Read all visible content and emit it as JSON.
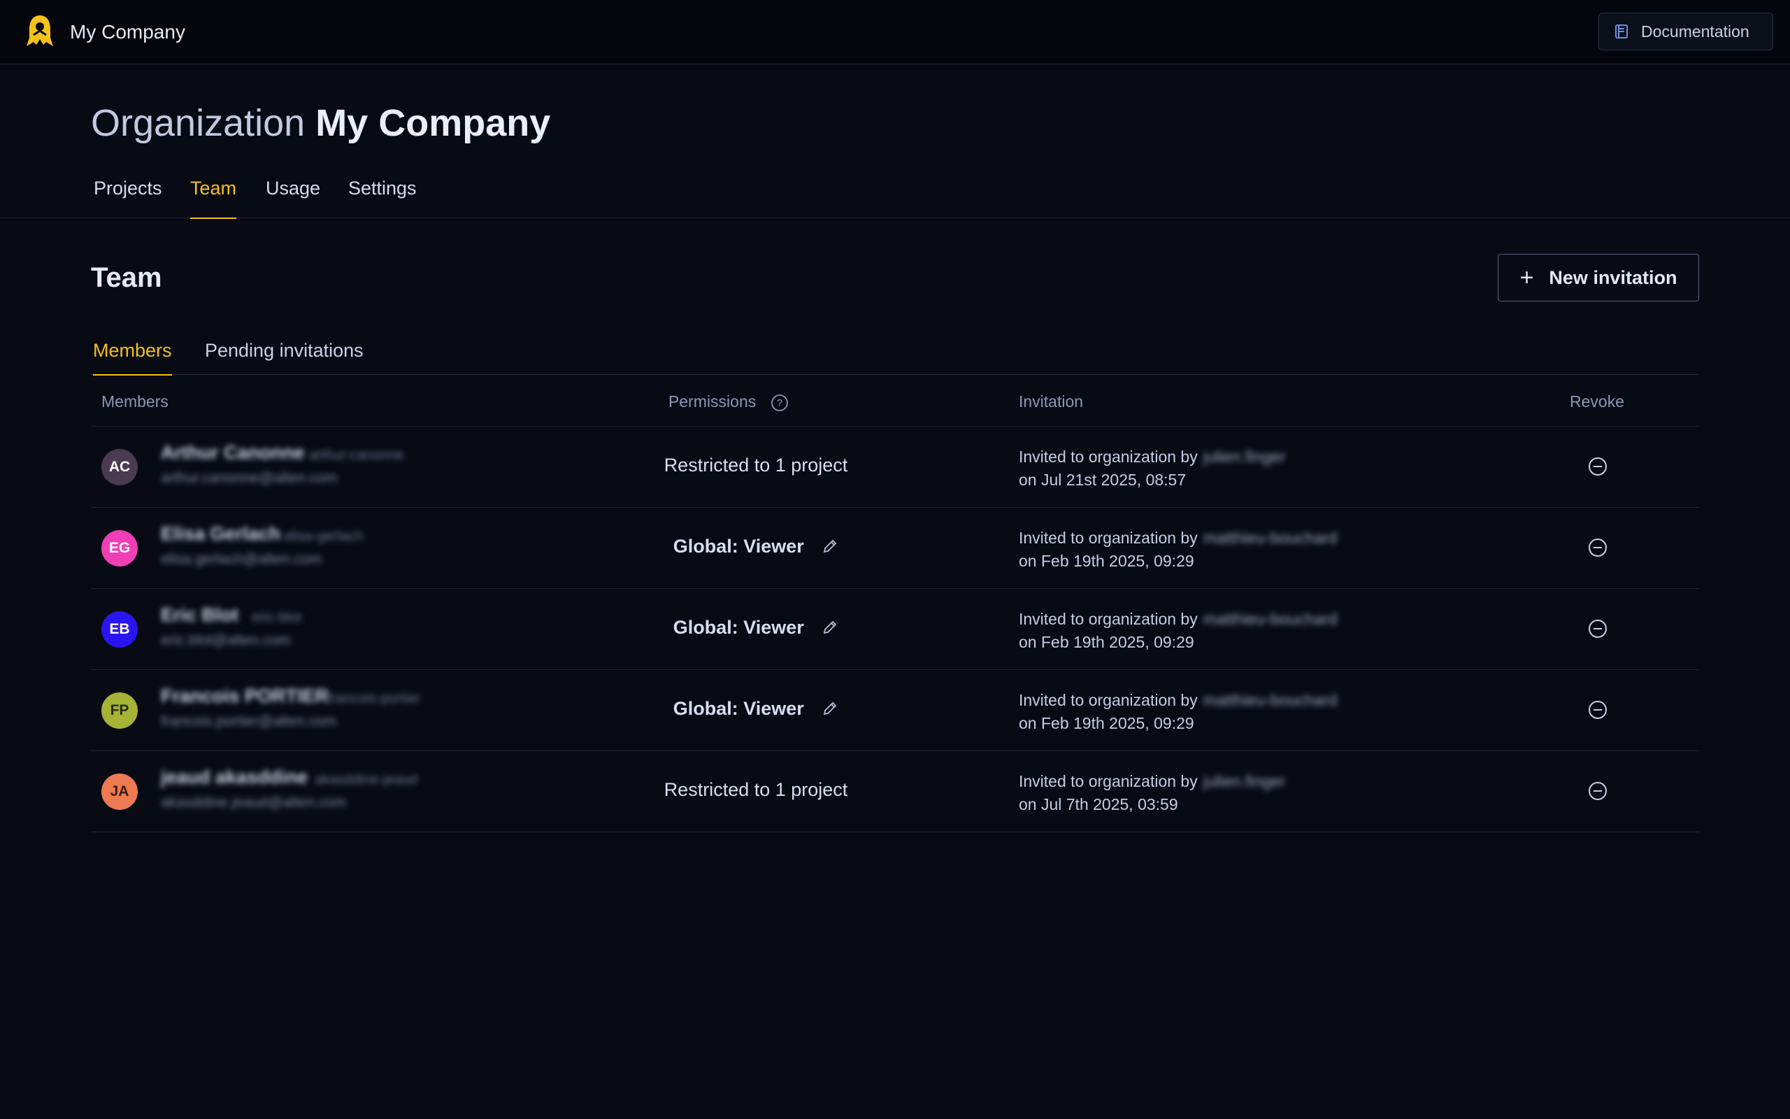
{
  "topbar": {
    "company_name": "My Company",
    "doc_label": "Documentation"
  },
  "header": {
    "title_prefix": "Organization",
    "title_name": "My Company"
  },
  "main_tabs": [
    {
      "label": "Projects",
      "active": false
    },
    {
      "label": "Team",
      "active": true
    },
    {
      "label": "Usage",
      "active": false
    },
    {
      "label": "Settings",
      "active": false
    }
  ],
  "section": {
    "title": "Team",
    "new_invitation_label": "New invitation"
  },
  "sub_tabs": [
    {
      "label": "Members",
      "active": true
    },
    {
      "label": "Pending invitations",
      "active": false
    }
  ],
  "table": {
    "headers": {
      "members": "Members",
      "permissions": "Permissions",
      "invitation": "Invitation",
      "revoke": "Revoke"
    },
    "rows": [
      {
        "initials": "AC",
        "avatar_color": "#4a3a52",
        "name": "Arthur Canonne",
        "handle": "arthur-canonne",
        "email": "arthur.canonne@alten.com",
        "permission": "Restricted to 1 project",
        "invited_text": "Invited to organization by",
        "invited_by": "julien.finger",
        "invited_on": "on Jul 21st 2025, 08:57"
      },
      {
        "initials": "EG",
        "avatar_color": "#f03fb6",
        "name": "Elisa Gerlach",
        "handle": "elisa-gerlach",
        "email": "elisa.gerlach@alten.com",
        "permission": "Global: Viewer",
        "invited_text": "Invited to organization by",
        "invited_by": "matthieu-bouchard",
        "invited_on": "on Feb 19th 2025, 09:29"
      },
      {
        "initials": "EB",
        "avatar_color": "#2a14f0",
        "name": "Eric Blot",
        "handle": "eric-blot",
        "email": "eric.blot@alten.com",
        "permission": "Global: Viewer",
        "invited_text": "Invited to organization by",
        "invited_by": "matthieu-bouchard",
        "invited_on": "on Feb 19th 2025, 09:29"
      },
      {
        "initials": "FP",
        "avatar_color": "#a6b336",
        "name": "Francois PORTIER",
        "handle": "francois-portier",
        "email": "francois.portier@alten.com",
        "permission": "Global: Viewer",
        "invited_text": "Invited to organization by",
        "invited_by": "matthieu-bouchard",
        "invited_on": "on Feb 19th 2025, 09:29"
      },
      {
        "initials": "JA",
        "avatar_color": "#ee7a52",
        "name": "jeaud akasddine",
        "handle": "akasddine-jeaud",
        "email": "akasddine.jeaud@alten.com",
        "permission": "Restricted to 1 project",
        "invited_text": "Invited to organization by",
        "invited_by": "julien.finger",
        "invited_on": "on Jul 7th 2025, 03:59"
      }
    ]
  }
}
